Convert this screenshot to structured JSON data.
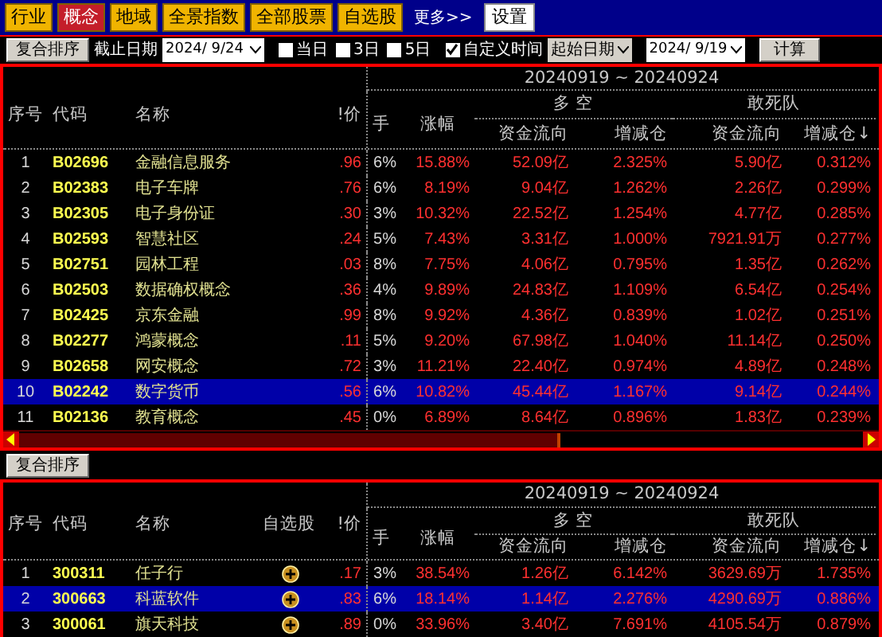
{
  "nav": {
    "items": [
      {
        "label": "行业",
        "selected": false
      },
      {
        "label": "概念",
        "selected": true
      },
      {
        "label": "地域",
        "selected": false
      },
      {
        "label": "全景指数",
        "selected": false
      },
      {
        "label": "全部股票",
        "selected": false
      },
      {
        "label": "自选股",
        "selected": false
      }
    ],
    "more": "更多>>",
    "settings": "设置"
  },
  "toolbar": {
    "sort_button": "复合排序",
    "end_date_label": "截止日期",
    "end_date": "2024/ 9/24",
    "periods": [
      {
        "label": "当日",
        "checked": false
      },
      {
        "label": "3日",
        "checked": false
      },
      {
        "label": "5日",
        "checked": false
      },
      {
        "label": "自定义时间",
        "checked": true
      }
    ],
    "start_select": "起始日期",
    "start_date": "2024/ 9/19",
    "calc_button": "计算"
  },
  "panel1": {
    "date_range": "20240919 ~ 20240924",
    "groups": [
      "多 空",
      "敢死队"
    ],
    "columns": [
      "序号",
      "代码",
      "名称",
      "!价",
      "手",
      "涨幅",
      "资金流向",
      "增减仓",
      "资金流向",
      "增减仓↓"
    ],
    "rows": [
      {
        "cells": [
          "1",
          "B02696",
          "金融信息服务",
          ".96",
          "6%",
          "15.88%",
          "52.09亿",
          "2.325%",
          "5.90亿",
          "0.312%"
        ],
        "selected": false
      },
      {
        "cells": [
          "2",
          "B02383",
          "电子车牌",
          ".76",
          "6%",
          "8.19%",
          "9.04亿",
          "1.262%",
          "2.26亿",
          "0.299%"
        ],
        "selected": false
      },
      {
        "cells": [
          "3",
          "B02305",
          "电子身份证",
          ".30",
          "3%",
          "10.32%",
          "22.52亿",
          "1.254%",
          "4.77亿",
          "0.285%"
        ],
        "selected": false
      },
      {
        "cells": [
          "4",
          "B02593",
          "智慧社区",
          ".24",
          "5%",
          "7.43%",
          "3.31亿",
          "1.000%",
          "7921.91万",
          "0.277%"
        ],
        "selected": false
      },
      {
        "cells": [
          "5",
          "B02751",
          "园林工程",
          ".03",
          "8%",
          "7.75%",
          "4.06亿",
          "0.795%",
          "1.35亿",
          "0.262%"
        ],
        "selected": false
      },
      {
        "cells": [
          "6",
          "B02503",
          "数据确权概念",
          ".36",
          "4%",
          "9.89%",
          "24.83亿",
          "1.109%",
          "6.54亿",
          "0.254%"
        ],
        "selected": false
      },
      {
        "cells": [
          "7",
          "B02425",
          "京东金融",
          ".99",
          "8%",
          "9.92%",
          "4.36亿",
          "0.839%",
          "1.02亿",
          "0.251%"
        ],
        "selected": false
      },
      {
        "cells": [
          "8",
          "B02277",
          "鸿蒙概念",
          ".11",
          "5%",
          "9.20%",
          "67.98亿",
          "1.040%",
          "11.14亿",
          "0.250%"
        ],
        "selected": false
      },
      {
        "cells": [
          "9",
          "B02658",
          "网安概念",
          ".72",
          "3%",
          "11.21%",
          "22.40亿",
          "0.974%",
          "4.89亿",
          "0.248%"
        ],
        "selected": false
      },
      {
        "cells": [
          "10",
          "B02242",
          "数字货币",
          ".56",
          "6%",
          "10.82%",
          "45.44亿",
          "1.167%",
          "9.14亿",
          "0.244%"
        ],
        "selected": true
      },
      {
        "cells": [
          "11",
          "B02136",
          "教育概念",
          ".45",
          "0%",
          "6.89%",
          "8.64亿",
          "0.896%",
          "1.83亿",
          "0.239%"
        ],
        "selected": false
      }
    ]
  },
  "panel2": {
    "sort_button": "复合排序",
    "date_range": "20240919 ~ 20240924",
    "groups": [
      "多 空",
      "敢死队"
    ],
    "columns": [
      "序号",
      "代码",
      "名称",
      "自选股",
      "!价",
      "手",
      "涨幅",
      "资金流向",
      "增减仓",
      "资金流向",
      "增减仓↓"
    ],
    "rows": [
      {
        "cells": [
          "1",
          "300311",
          "任子行",
          "",
          ".17",
          "3%",
          "38.54%",
          "1.26亿",
          "6.142%",
          "3629.69万",
          "1.735%"
        ],
        "selected": false
      },
      {
        "cells": [
          "2",
          "300663",
          "科蓝软件",
          "",
          ".83",
          "6%",
          "18.14%",
          "1.14亿",
          "2.276%",
          "4290.69万",
          "0.886%"
        ],
        "selected": true
      },
      {
        "cells": [
          "3",
          "300061",
          "旗天科技",
          "",
          ".89",
          "0%",
          "33.96%",
          "3.40亿",
          "7.691%",
          "4105.54万",
          "0.879%"
        ],
        "selected": false
      }
    ]
  }
}
